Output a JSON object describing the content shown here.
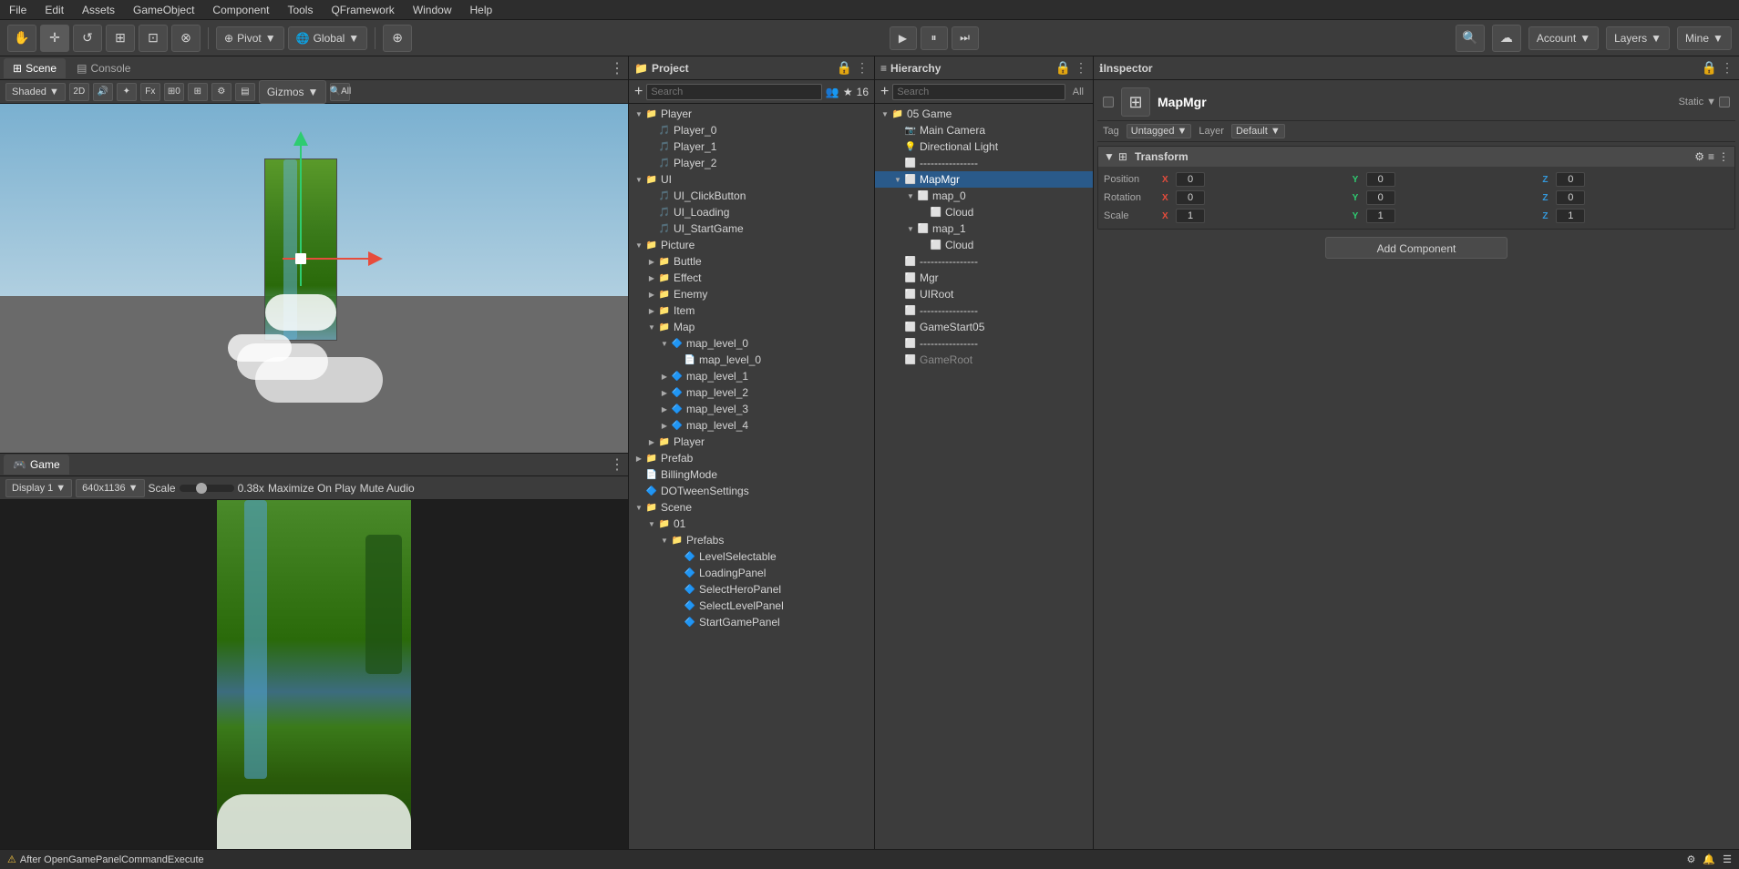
{
  "menubar": {
    "items": [
      "File",
      "Edit",
      "Assets",
      "GameObject",
      "Component",
      "Tools",
      "QFramework",
      "Window",
      "Help"
    ]
  },
  "toolbar": {
    "hand_tool": "✋",
    "move_tool": "✛",
    "rotate_tool": "↺",
    "scale_tool": "⊞",
    "rect_tool": "⊡",
    "transform_tool": "⊗",
    "pivot_label": "Pivot",
    "global_label": "Global",
    "center_icon": "⊕",
    "play_icon": "▶",
    "pause_icon": "⏸",
    "step_icon": "⏭",
    "cloud_icon": "☁",
    "account_label": "Account",
    "layers_label": "Layers",
    "mine_label": "Mine"
  },
  "scene_panel": {
    "tab_scene": "Scene",
    "tab_console": "Console",
    "shaded_label": "Shaded",
    "twod_label": "2D",
    "gizmos_label": "Gizmos",
    "all_label": "All",
    "zero_label": "0"
  },
  "game_panel": {
    "tab_game": "Game",
    "display_label": "Display 1",
    "resolution_label": "640x1136",
    "scale_label": "Scale",
    "scale_value": "0.38x",
    "maximize_label": "Maximize On Play",
    "mute_label": "Mute Audio"
  },
  "project_panel": {
    "title": "Project",
    "search_placeholder": "Search",
    "items_count": "16",
    "tree": [
      {
        "level": 0,
        "type": "folder",
        "arrow": "expanded",
        "label": "Player"
      },
      {
        "level": 1,
        "type": "music",
        "arrow": "none",
        "label": "Player_0"
      },
      {
        "level": 1,
        "type": "music",
        "arrow": "none",
        "label": "Player_1"
      },
      {
        "level": 1,
        "type": "music",
        "arrow": "none",
        "label": "Player_2"
      },
      {
        "level": 0,
        "type": "folder",
        "arrow": "expanded",
        "label": "UI"
      },
      {
        "level": 1,
        "type": "music",
        "arrow": "none",
        "label": "UI_ClickButton"
      },
      {
        "level": 1,
        "type": "music",
        "arrow": "none",
        "label": "UI_Loading"
      },
      {
        "level": 1,
        "type": "music",
        "arrow": "none",
        "label": "UI_StartGame"
      },
      {
        "level": 0,
        "type": "folder",
        "arrow": "expanded",
        "label": "Picture"
      },
      {
        "level": 1,
        "type": "folder",
        "arrow": "collapsed",
        "label": "Buttle"
      },
      {
        "level": 1,
        "type": "folder",
        "arrow": "collapsed",
        "label": "Effect"
      },
      {
        "level": 1,
        "type": "folder",
        "arrow": "collapsed",
        "label": "Enemy"
      },
      {
        "level": 1,
        "type": "folder",
        "arrow": "collapsed",
        "label": "Item"
      },
      {
        "level": 1,
        "type": "folder",
        "arrow": "expanded",
        "label": "Map"
      },
      {
        "level": 2,
        "type": "prefab",
        "arrow": "expanded",
        "label": "map_level_0"
      },
      {
        "level": 3,
        "type": "file",
        "arrow": "none",
        "label": "map_level_0"
      },
      {
        "level": 2,
        "type": "prefab",
        "arrow": "collapsed",
        "label": "map_level_1"
      },
      {
        "level": 2,
        "type": "prefab",
        "arrow": "collapsed",
        "label": "map_level_2"
      },
      {
        "level": 2,
        "type": "prefab",
        "arrow": "collapsed",
        "label": "map_level_3"
      },
      {
        "level": 2,
        "type": "prefab",
        "arrow": "collapsed",
        "label": "map_level_4"
      },
      {
        "level": 1,
        "type": "folder",
        "arrow": "collapsed",
        "label": "Player"
      },
      {
        "level": 0,
        "type": "folder",
        "arrow": "collapsed",
        "label": "Prefab"
      },
      {
        "level": 0,
        "type": "file",
        "arrow": "none",
        "label": "BillingMode"
      },
      {
        "level": 0,
        "type": "prefab",
        "arrow": "none",
        "label": "DOTweenSettings"
      },
      {
        "level": 0,
        "type": "folder",
        "arrow": "expanded",
        "label": "Scene"
      },
      {
        "level": 1,
        "type": "folder",
        "arrow": "expanded",
        "label": "01"
      },
      {
        "level": 2,
        "type": "folder",
        "arrow": "expanded",
        "label": "Prefabs"
      },
      {
        "level": 3,
        "type": "prefab",
        "arrow": "none",
        "label": "LevelSelectable"
      },
      {
        "level": 3,
        "type": "prefab",
        "arrow": "none",
        "label": "LoadingPanel"
      },
      {
        "level": 3,
        "type": "prefab",
        "arrow": "none",
        "label": "SelectHeroPanel"
      },
      {
        "level": 3,
        "type": "prefab",
        "arrow": "none",
        "label": "SelectLevelPanel"
      },
      {
        "level": 3,
        "type": "prefab",
        "arrow": "none",
        "label": "StartGamePanel"
      }
    ]
  },
  "hierarchy_panel": {
    "title": "Hierarchy",
    "search_all": "All",
    "tree": [
      {
        "level": 0,
        "type": "folder",
        "arrow": "expanded",
        "label": "05 Game",
        "selected": false
      },
      {
        "level": 1,
        "type": "camera",
        "arrow": "none",
        "label": "Main Camera",
        "selected": false
      },
      {
        "level": 1,
        "type": "light",
        "arrow": "none",
        "label": "Directional Light",
        "selected": false
      },
      {
        "level": 1,
        "type": "cube",
        "arrow": "none",
        "label": "----------------",
        "selected": false
      },
      {
        "level": 1,
        "type": "cube",
        "arrow": "expanded",
        "label": "MapMgr",
        "selected": true
      },
      {
        "level": 2,
        "type": "cube",
        "arrow": "expanded",
        "label": "map_0",
        "selected": false
      },
      {
        "level": 3,
        "type": "cube",
        "arrow": "none",
        "label": "Cloud",
        "selected": false
      },
      {
        "level": 2,
        "type": "cube",
        "arrow": "expanded",
        "label": "map_1",
        "selected": false
      },
      {
        "level": 3,
        "type": "cube",
        "arrow": "none",
        "label": "Cloud",
        "selected": false
      },
      {
        "level": 1,
        "type": "cube",
        "arrow": "none",
        "label": "----------------",
        "selected": false
      },
      {
        "level": 1,
        "type": "cube",
        "arrow": "none",
        "label": "Mgr",
        "selected": false
      },
      {
        "level": 1,
        "type": "cube",
        "arrow": "none",
        "label": "UIRoot",
        "selected": false
      },
      {
        "level": 1,
        "type": "cube",
        "arrow": "none",
        "label": "----------------",
        "selected": false
      },
      {
        "level": 1,
        "type": "cube",
        "arrow": "none",
        "label": "GameStart05",
        "selected": false
      },
      {
        "level": 1,
        "type": "cube",
        "arrow": "none",
        "label": "----------------",
        "selected": false
      },
      {
        "level": 1,
        "type": "cube",
        "arrow": "none",
        "label": "GameRoot",
        "selected": false,
        "dim": true
      }
    ]
  },
  "inspector_panel": {
    "title": "Inspector",
    "object_name": "MapMgr",
    "static_label": "Static",
    "tag_label": "Tag",
    "tag_value": "Untagged",
    "layer_label": "Layer",
    "layer_value": "Default",
    "transform_title": "Transform",
    "position_label": "Position",
    "rotation_label": "Rotation",
    "scale_label": "Scale",
    "pos_x": "0",
    "pos_y": "0",
    "pos_z": "0",
    "rot_x": "0",
    "rot_y": "0",
    "rot_z": "0",
    "scale_x": "1",
    "scale_y": "1",
    "scale_z": "1",
    "add_component": "Add Component"
  },
  "status_bar": {
    "message": "After OpenGamePanelCommandExecute",
    "icon": "⚠"
  }
}
